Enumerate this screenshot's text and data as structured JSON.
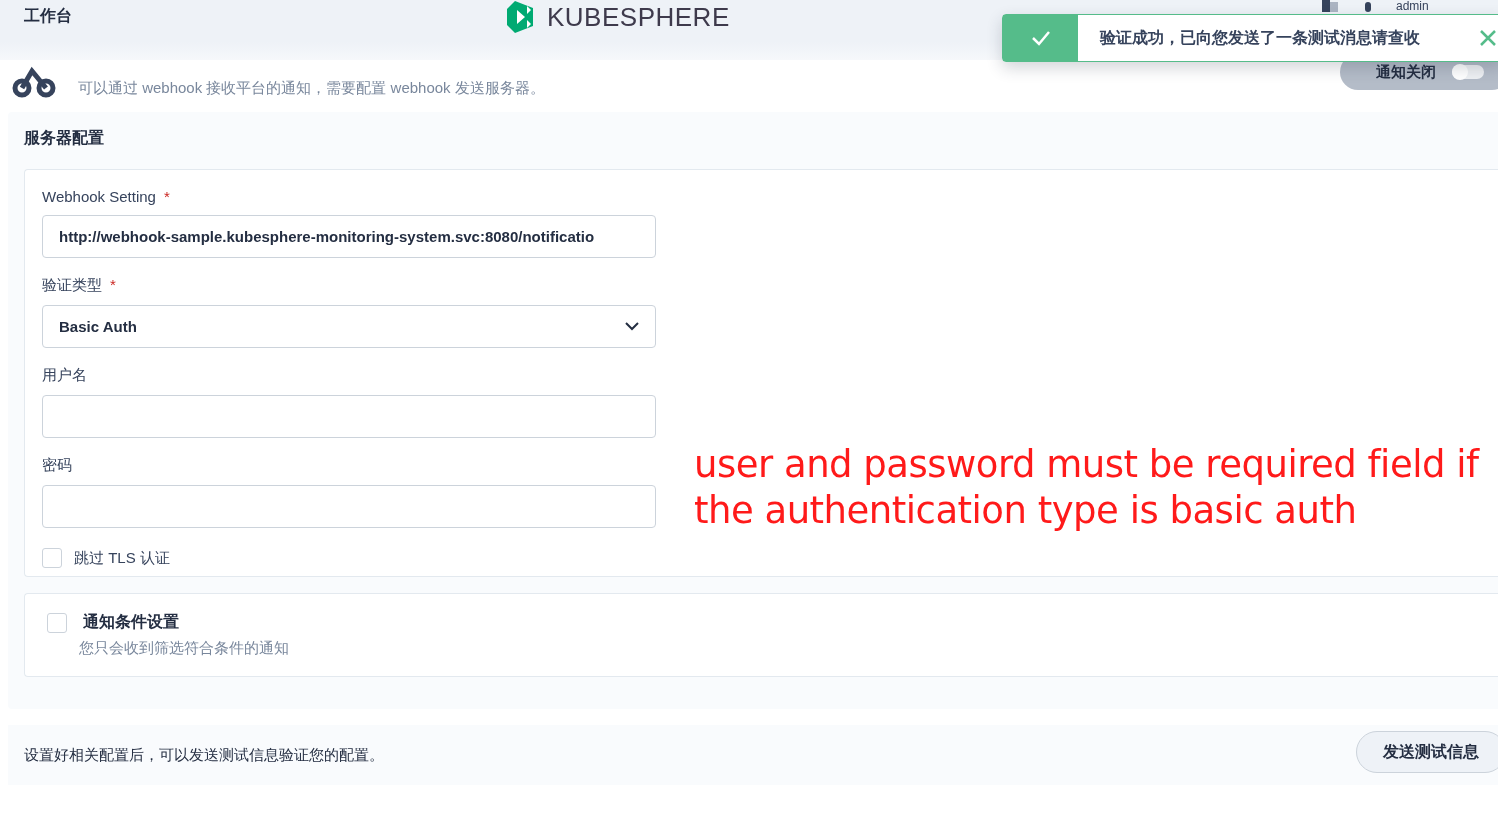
{
  "header": {
    "title": "工作台",
    "logo": "KUBESPHERE",
    "user": "admin"
  },
  "toast": {
    "kind": "success",
    "message": "验证成功，已向您发送了一条测试消息请查收"
  },
  "channel": {
    "description": "可以通过 webhook 接收平台的通知，需要配置 webhook 发送服务器。",
    "toggle_label": "通知关闭",
    "on": false
  },
  "server_config": {
    "title": "服务器配置",
    "required_mark": "*",
    "fields": [
      {
        "kind": "text",
        "label": "Webhook Setting",
        "required": true,
        "value": "http://webhook-sample.kubesphere-monitoring-system.svc:8080/notificatio"
      },
      {
        "kind": "select",
        "label": "验证类型",
        "required": true,
        "value": "Basic Auth"
      },
      {
        "kind": "text",
        "label": "用户名",
        "required": false
      },
      {
        "kind": "password",
        "label": "密码",
        "required": false
      }
    ],
    "skip_tls": {
      "label": "跳过 TLS 认证",
      "checked": false
    }
  },
  "annotation": "user and password must be required field  if the authentication type is basic auth",
  "conditions": {
    "title": "通知条件设置",
    "description": "您只会收到筛选符合条件的通知",
    "checked": false
  },
  "footer": {
    "hint": "设置好相关配置后，可以发送测试信息验证您的配置。",
    "button": "发送测试信息"
  }
}
